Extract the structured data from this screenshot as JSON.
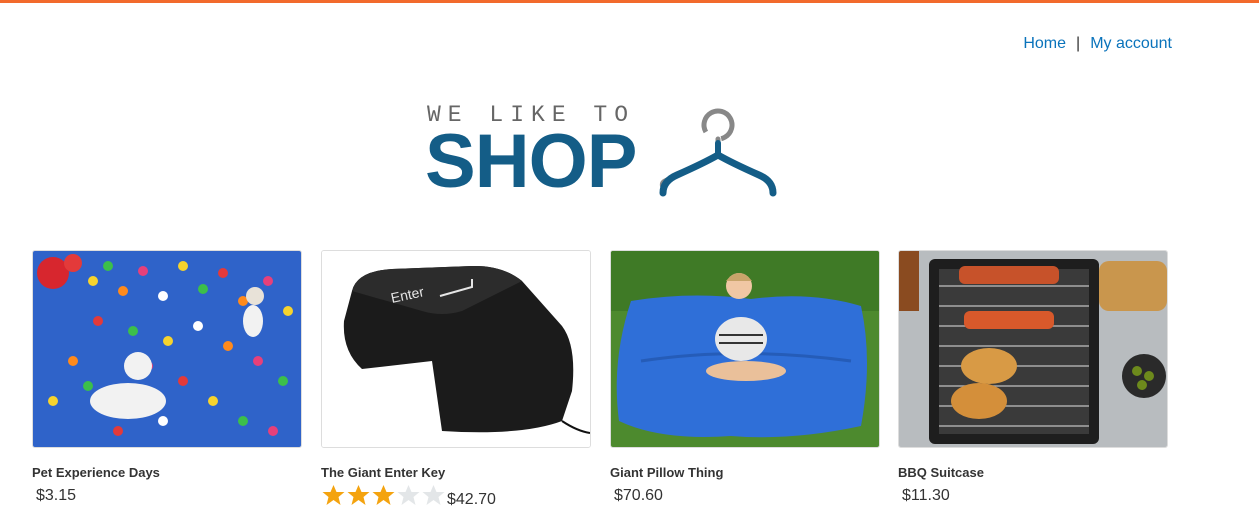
{
  "nav": {
    "home_label": "Home",
    "separator": "|",
    "account_label": "My account"
  },
  "logo": {
    "tagline": "WE LIKE TO",
    "wordmark": "SHOP",
    "icon": "hanger-icon",
    "colors": {
      "wordmark": "#145d87",
      "tagline": "#666666"
    }
  },
  "accent_color": "#f26a2c",
  "link_color": "#0a73bb",
  "products": [
    {
      "title": "Pet Experience Days",
      "price": "$3.15",
      "image": "dogs-with-balloons-image"
    },
    {
      "title": "The Giant Enter Key",
      "price": "$42.70",
      "rating": 3,
      "rating_max": 5,
      "image": "giant-enter-key-image"
    },
    {
      "title": "Giant Pillow Thing",
      "price": "$70.60",
      "image": "giant-pillow-image"
    },
    {
      "title": "BBQ Suitcase",
      "price": "$11.30",
      "image": "bbq-suitcase-image"
    }
  ]
}
